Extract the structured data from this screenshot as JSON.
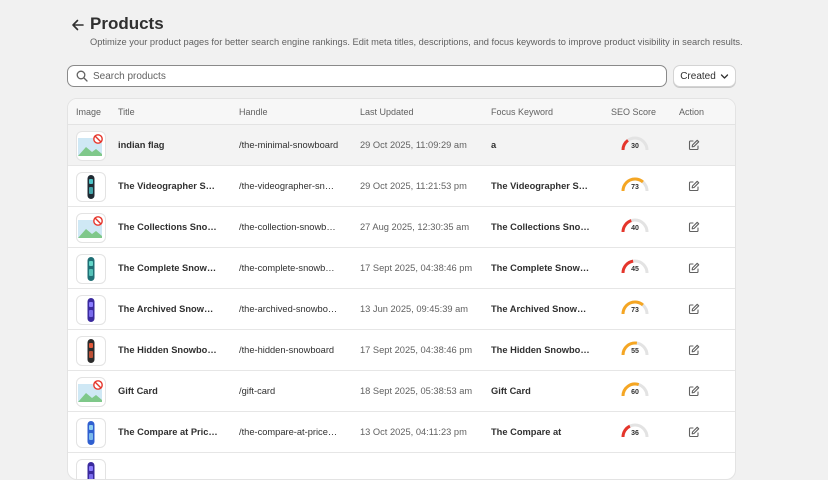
{
  "header": {
    "title": "Products",
    "description": "Optimize your product pages for better search engine rankings. Edit meta titles, descriptions, and focus keywords to improve product visibility in search results."
  },
  "search": {
    "placeholder": "Search products"
  },
  "sort": {
    "label": "Created"
  },
  "table": {
    "columns": [
      "Image",
      "Title",
      "Handle",
      "Last Updated",
      "Focus Keyword",
      "SEO Score",
      "Action"
    ],
    "rows": [
      {
        "image": "placeholder",
        "title": "indian flag",
        "handle": "/the-minimal-snowboard",
        "updated": "29 Oct 2025, 11:09:29 am",
        "keyword": "a",
        "score": 30
      },
      {
        "image": "snowboard-black",
        "title": "The Videographer Snowboard",
        "handle": "/the-videographer-snowboard",
        "updated": "29 Oct 2025, 11:21:53 pm",
        "keyword": "The Videographer Snowboard",
        "score": 73
      },
      {
        "image": "placeholder",
        "title": "The Collections Snowboard",
        "handle": "/the-collection-snowboard",
        "updated": "27 Aug 2025, 12:30:35 am",
        "keyword": "The Collections Snowboard",
        "score": 40
      },
      {
        "image": "snowboard-teal",
        "title": "The Complete Snowboard",
        "handle": "/the-complete-snowboard",
        "updated": "17 Sept 2025, 04:38:46 pm",
        "keyword": "The Complete Snowboard",
        "score": 45
      },
      {
        "image": "snowboard-purple",
        "title": "The Archived Snowboard",
        "handle": "/the-archived-snowboard",
        "updated": "13 Jun 2025, 09:45:39 am",
        "keyword": "The Archived Snowboard",
        "score": 73
      },
      {
        "image": "snowboard-dark",
        "title": "The Hidden Snowboard",
        "handle": "/the-hidden-snowboard",
        "updated": "17 Sept 2025, 04:38:46 pm",
        "keyword": "The Hidden Snowboard",
        "score": 55
      },
      {
        "image": "placeholder",
        "title": "Gift Card",
        "handle": "/gift-card",
        "updated": "18 Sept 2025, 05:38:53 am",
        "keyword": "Gift Card",
        "score": 60
      },
      {
        "image": "snowboard-blue",
        "title": "The Compare at Price Snowboard",
        "handle": "/the-compare-at-price-snowboard",
        "updated": "13 Oct 2025, 04:11:23 pm",
        "keyword": "The Compare at",
        "score": 36
      },
      {
        "image": "snowboard-purple",
        "title": "",
        "handle": "",
        "updated": "",
        "keyword": "",
        "score": null
      }
    ]
  },
  "colors": {
    "score_low": "#e5352b",
    "score_mid": "#f5a623",
    "gauge_track": "#e3e3e3",
    "placeholder_sky": "#cfe8f5",
    "placeholder_hill": "#7fc88a",
    "no_sign": "#e5352b"
  },
  "icons": {
    "back": "arrow-left-icon",
    "search": "search-icon",
    "sort": "chevron-down-icon",
    "edit": "edit-icon",
    "placeholder": "image-placeholder-icon"
  }
}
